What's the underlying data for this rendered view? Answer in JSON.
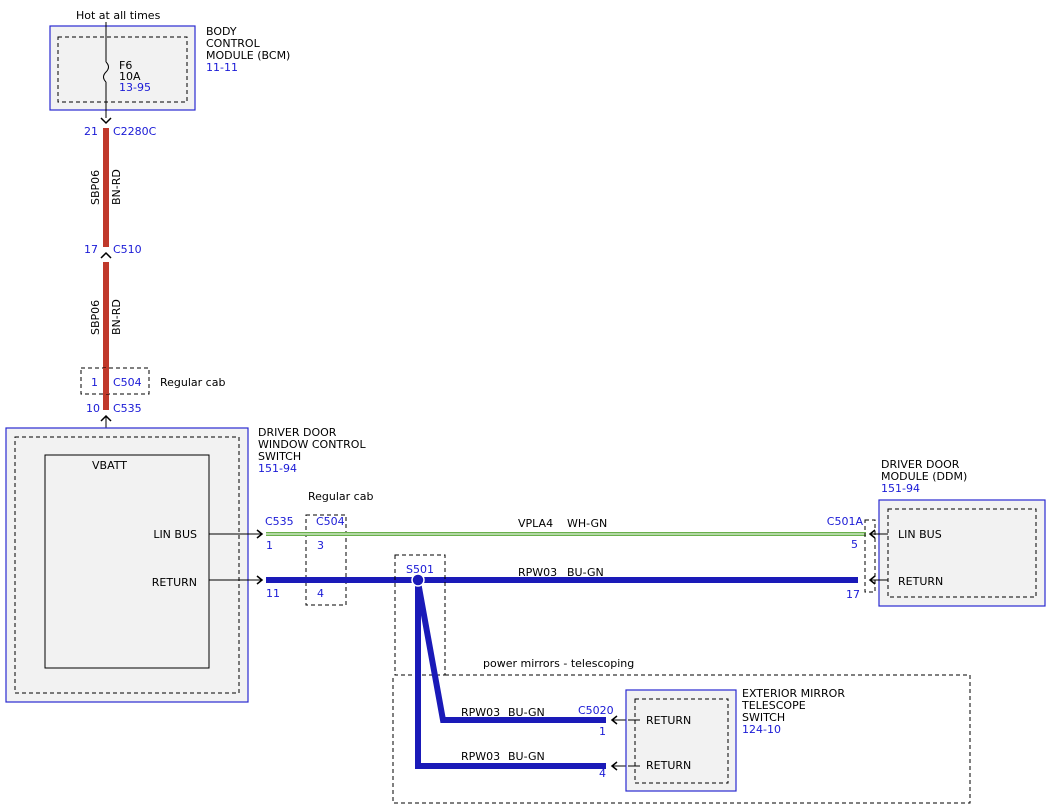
{
  "hot_at_all_times": "Hot at all times",
  "bcm": {
    "line1": "BODY",
    "line2": "CONTROL",
    "line3": "MODULE (BCM)",
    "ref": "11-11",
    "fuse_name": "F6",
    "fuse_rating": "10A",
    "fuse_ref": "13-95"
  },
  "connectors": {
    "c2280c_pin": "21",
    "c2280c": "C2280C",
    "c510_pin": "17",
    "c510": "C510",
    "c504_pin": "1",
    "c504": "C504",
    "c504_note": "Regular cab",
    "c535_pin": "10",
    "c535": "C535"
  },
  "wire_sbp06": {
    "circuit": "SBP06",
    "color": "BN-RD"
  },
  "ddwcs": {
    "line1": "DRIVER DOOR",
    "line2": "WINDOW CONTROL",
    "line3": "SWITCH",
    "ref": "151-94",
    "vbatt": "VBATT",
    "lin_bus": "LIN BUS",
    "return": "RETURN"
  },
  "lin_row": {
    "c535": "C535",
    "c535_pin": "1",
    "c504": "C504",
    "c504_pin": "3",
    "regular_cab": "Regular cab",
    "circuit": "VPLA4",
    "color": "WH-GN",
    "c501a": "C501A",
    "c501a_pin": "5"
  },
  "return_row": {
    "c535_pin": "11",
    "c504_pin": "4",
    "splice": "S501",
    "circuit": "RPW03",
    "color": "BU-GN",
    "c501a_pin": "17"
  },
  "ddm": {
    "line1": "DRIVER DOOR",
    "line2": "MODULE (DDM)",
    "ref": "151-94",
    "lin_bus": "LIN BUS",
    "return": "RETURN"
  },
  "option_note": "power mirrors - telescoping",
  "mirror_branch": {
    "circuit1": "RPW03",
    "color1": "BU-GN",
    "c5020": "C5020",
    "pin1": "1",
    "circuit2": "RPW03",
    "color2": "BU-GN",
    "pin2": "4"
  },
  "mirror_switch": {
    "line1": "EXTERIOR MIRROR",
    "line2": "TELESCOPE",
    "line3": "SWITCH",
    "ref": "124-10",
    "return1": "RETURN",
    "return2": "RETURN"
  },
  "colors": {
    "module_outline": "#2a2ad0",
    "power_wire": "#c0392b",
    "lin_wire": "#6ab04c",
    "return_wire": "#1a1ab8",
    "link_text": "#1a1ad6"
  }
}
